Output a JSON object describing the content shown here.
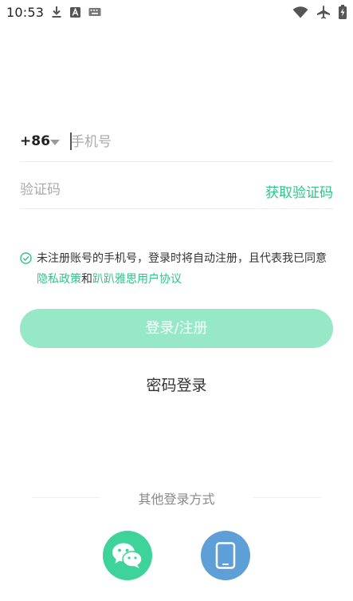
{
  "status_bar": {
    "time": "10:53",
    "icons_left": [
      "download-icon",
      "font-a-icon",
      "keyboard-icon"
    ],
    "icons_right": [
      "wifi-icon",
      "airplane-icon",
      "battery-charging-icon"
    ]
  },
  "login_form": {
    "country_code": "+86",
    "phone_placeholder": "手机号",
    "code_placeholder": "验证码",
    "get_code_label": "获取验证码"
  },
  "agreement": {
    "text_before": "未注册账号的手机号，登录时将自动注册，且代表我已同意",
    "privacy_link": "隐私政策",
    "and_text": "和",
    "terms_link": "趴趴雅思用户协议"
  },
  "actions": {
    "login_label": "登录/注册",
    "password_login_label": "密码登录"
  },
  "other_login": {
    "label": "其他登录方式",
    "methods": [
      "wechat-icon",
      "mobile-phone-icon"
    ]
  },
  "colors": {
    "accent": "#2ec48a",
    "button_disabled": "#96e8c7",
    "wechat": "#3dd39b",
    "device": "#5f9fd8"
  }
}
